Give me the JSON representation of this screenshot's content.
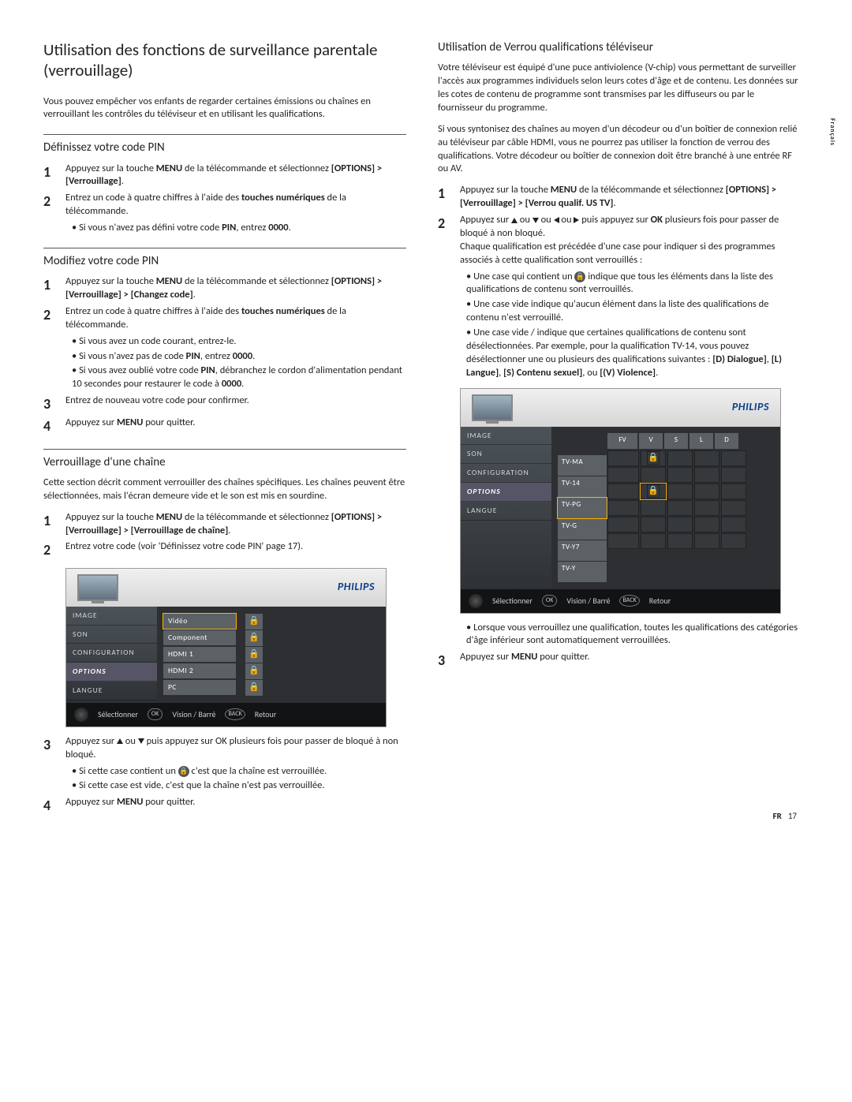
{
  "side_tab": "Français",
  "footer": {
    "lang": "FR",
    "page": "17"
  },
  "col1": {
    "h1": "Utilisation des fonctions de surveillance parentale (verrouillage)",
    "p1": "Vous pouvez empêcher vos enfants de regarder certaines émissions ou chaînes en verrouillant les contrôles du téléviseur et en utilisant les qualifications.",
    "s1": {
      "h": "Définissez votre code PIN",
      "st1a": "Appuyez sur la touche ",
      "st1b": "MENU",
      "st1c": " de la télécommande et sélectionnez ",
      "st1d": "[OPTIONS] > [Verrouillage]",
      "st1e": ".",
      "st2a": "Entrez un code à quatre chiffres à l'aide des ",
      "st2b": "touches numériques",
      "st2c": " de la télécommande.",
      "b1a": "Si vous n'avez pas défini votre code ",
      "b1b": "PIN",
      "b1c": ", entrez ",
      "b1d": "0000",
      "b1e": "."
    },
    "s2": {
      "h": "Modifiez votre code PIN",
      "st1a": "Appuyez sur la touche ",
      "st1b": "MENU",
      "st1c": " de la télécommande et sélectionnez ",
      "st1d": "[OPTIONS] > [Verrouillage] > [Changez code]",
      "st1e": ".",
      "st2a": "Entrez un code à quatre chiffres à l'aide des ",
      "st2b": "touches numériques",
      "st2c": " de la télécommande.",
      "b1": "Si vous avez un code courant, entrez-le.",
      "b2a": "Si vous n'avez pas de code ",
      "b2b": "PIN",
      "b2c": ", entrez ",
      "b2d": "0000",
      "b2e": ".",
      "b3a": "Si vous avez oublié votre code ",
      "b3b": "PIN",
      "b3c": ", débranchez le cordon d'alimentation pendant 10 secondes pour restaurer le code à ",
      "b3d": "0000",
      "b3e": ".",
      "st3": "Entrez de nouveau votre code pour confirmer.",
      "st4a": "Appuyez sur ",
      "st4b": "MENU",
      "st4c": " pour quitter."
    },
    "s3": {
      "h": "Verrouillage d'une chaîne",
      "p": "Cette section décrit comment verrouiller des chaînes spécifiques. Les chaînes peuvent être sélectionnées, mais l'écran demeure vide et le son est mis en sourdine.",
      "st1a": "Appuyez sur la touche ",
      "st1b": "MENU",
      "st1c": " de la télécommande et sélectionnez ",
      "st1d": "[OPTIONS] > [Verrouillage] > [Verrouillage de chaîne]",
      "st1e": ".",
      "st2": "Entrez votre code (voir 'Définissez votre code PIN' page 17).",
      "st3a": "Appuyez sur ",
      "st3b": " ou ",
      "st3c": " puis appuyez sur OK  plusieurs fois pour passer de bloqué à non bloqué.",
      "b1a": "Si cette case contient un ",
      "b1b": " c'est que la chaîne est verrouillée.",
      "b2": "Si cette case est vide, c'est que la chaîne n'est pas verrouillée.",
      "st4a": "Appuyez sur ",
      "st4b": "MENU",
      "st4c": " pour quitter."
    },
    "tv1": {
      "brand": "PHILIPS",
      "menu": [
        "IMAGE",
        "SON",
        "CONFIGURATION",
        "OPTIONS",
        "LANGUE"
      ],
      "channels": [
        "Vidéo",
        "Component",
        "HDMI 1",
        "HDMI 2",
        "PC"
      ],
      "foot_sel": "Sélectionner",
      "foot_vision": "Vision / Barré",
      "foot_back": "Retour",
      "ok": "OK",
      "back": "BACK"
    }
  },
  "col2": {
    "h2": "Utilisation de Verrou qualifications téléviseur",
    "p1": "Votre téléviseur est équipé d'une puce antiviolence (V-chip) vous permettant de surveiller l'accès aux programmes individuels selon leurs cotes d'âge et de contenu. Les données sur les cotes de contenu de programme sont transmises par les diffuseurs ou par le fournisseur du programme.",
    "p2": "Si vous syntonisez des chaînes au moyen d'un décodeur ou d'un boîtier de connexion relié au téléviseur par câble HDMI, vous ne pourrez pas utiliser la fonction de verrou des qualifications. Votre décodeur ou boîtier de connexion doit être branché à une entrée RF ou AV.",
    "st1a": "Appuyez sur la touche ",
    "st1b": "MENU",
    "st1c": " de la télécommande et sélectionnez ",
    "st1d": "[OPTIONS] > [Verrouillage] > [Verrou qualif. US TV]",
    "st1e": ".",
    "st2a": "Appuyez sur ",
    "st2b": " ou ",
    "st2c": " ou ",
    "st2d": " ou ",
    "st2e": " puis appuyez sur ",
    "st2f": "OK",
    "st2g": " plusieurs fois pour passer de bloqué à non bloqué.",
    "st2h": "Chaque qualification est précédée d'une case pour indiquer si des programmes associés à cette qualification sont verrouillés :",
    "b1a": "Une case qui contient un ",
    "b1b": " indique que tous les éléments dans la liste des qualifications de contenu sont verrouillés.",
    "b2": "Une case vide indique qu'aucun élément dans la liste des qualifications de contenu n'est verrouillé.",
    "b3a": "Une case vide / indique que certaines qualifications de contenu sont désélectionnées. Par exemple, pour la qualification TV-14, vous pouvez désélectionner une ou plusieurs des qualifications suivantes : ",
    "b3b": "[D) Dialogue]",
    "b3c": ", ",
    "b3d": "[L) Langue]",
    "b3e": ", ",
    "b3f": "[S) Contenu sexuel]",
    "b3g": ", ou ",
    "b3h": "[(V) Violence]",
    "b3i": ".",
    "bpost": "Lorsque vous verrouillez une qualification, toutes les qualifications des catégories d'âge inférieur sont automatiquement verrouillées.",
    "st3a": "Appuyez sur ",
    "st3b": "MENU",
    "st3c": " pour quitter.",
    "tv2": {
      "brand": "PHILIPS",
      "menu": [
        "IMAGE",
        "SON",
        "CONFIGURATION",
        "OPTIONS",
        "LANGUE"
      ],
      "ratings": [
        "TV-MA",
        "TV-14",
        "TV-PG",
        "TV-G",
        "TV-Y7",
        "TV-Y"
      ],
      "hdr": [
        "FV",
        "V",
        "S",
        "L",
        "D"
      ],
      "foot_sel": "Sélectionner",
      "foot_vision": "Vision / Barré",
      "foot_back": "Retour",
      "ok": "OK",
      "back": "BACK"
    }
  }
}
